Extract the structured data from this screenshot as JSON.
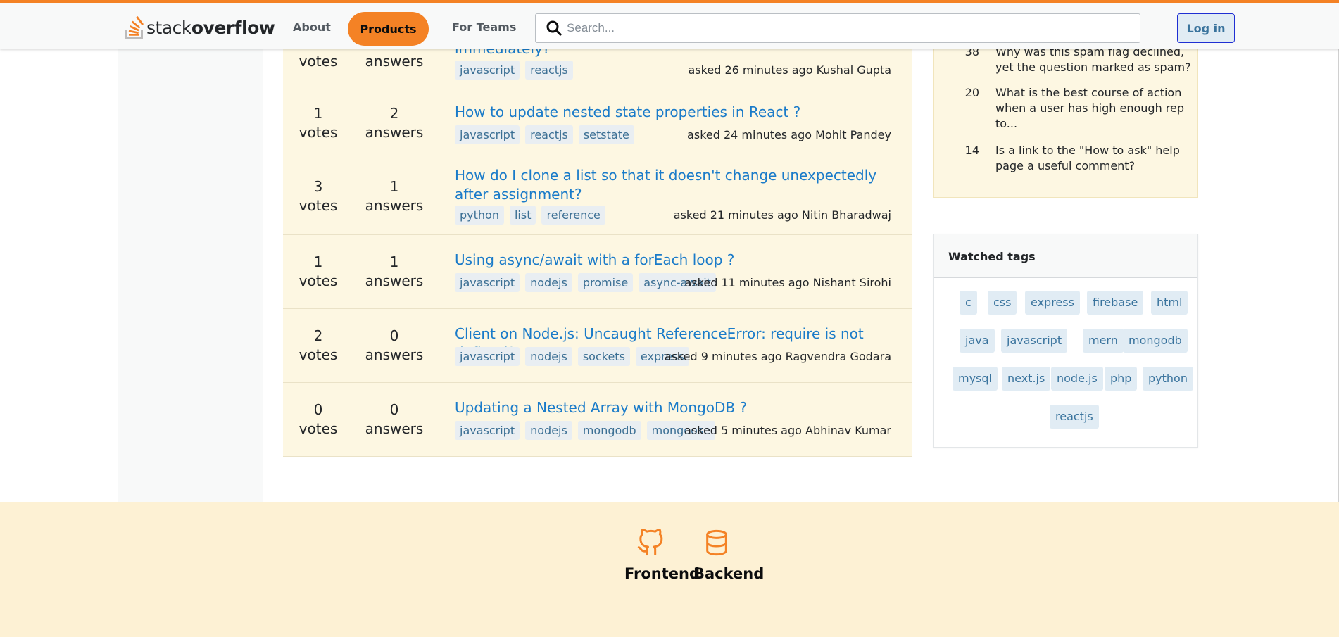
{
  "header": {
    "logo_stack": "stack",
    "logo_overflow": "overflow",
    "nav_about": "About",
    "nav_products": "Products",
    "nav_teams": "For Teams",
    "search_placeholder": "Search...",
    "login_label": "Log in",
    "accent_color": "#f48225"
  },
  "questions": [
    {
      "votes": "",
      "votes_label": "votes",
      "answers": "",
      "answers_label": "answers",
      "title": "immediately?",
      "tags": [
        "javascript",
        "reactjs"
      ],
      "asked": "asked 26 minutes ago",
      "author": "Kushal Gupta"
    },
    {
      "votes": "1",
      "votes_label": "votes",
      "answers": "2",
      "answers_label": "answers",
      "title": "How to update nested state properties in React ?",
      "tags": [
        "javascript",
        "reactjs",
        "setstate"
      ],
      "asked": "asked 24 minutes ago",
      "author": "Mohit Pandey"
    },
    {
      "votes": "3",
      "votes_label": "votes",
      "answers": "1",
      "answers_label": "answers",
      "title": "How do I clone a list so that it doesn't change unexpectedly after assignment?",
      "tags": [
        "python",
        "list",
        "reference"
      ],
      "asked": "asked 21 minutes ago",
      "author": "Nitin Bharadwaj"
    },
    {
      "votes": "1",
      "votes_label": "votes",
      "answers": "1",
      "answers_label": "answers",
      "title": "Using async/await with a forEach loop ?",
      "tags": [
        "javascript",
        "nodejs",
        "promise",
        "async-await"
      ],
      "asked": "asked 11 minutes ago",
      "author": "Nishant Sirohi"
    },
    {
      "votes": "2",
      "votes_label": "votes",
      "answers": "0",
      "answers_label": "answers",
      "title": "Client on Node.js: Uncaught ReferenceError: require is not defined?",
      "tags": [
        "javascript",
        "nodejs",
        "sockets",
        "express"
      ],
      "asked": "asked 9 minutes ago",
      "author": "Ragvendra Godara"
    },
    {
      "votes": "0",
      "votes_label": "votes",
      "answers": "0",
      "answers_label": "answers",
      "title": "Updating a Nested Array with MongoDB ?",
      "tags": [
        "javascript",
        "nodejs",
        "mongodb",
        "mongoose"
      ],
      "asked": "asked 5 minutes ago",
      "author": "Abhinav Kumar"
    }
  ],
  "featured": [
    {
      "count": "38",
      "text": "Why was this spam flag declined, yet the question marked as spam?"
    },
    {
      "count": "20",
      "text": "What is the best course of action when a user has high enough rep to..."
    },
    {
      "count": "14",
      "text": "Is a link to the \"How to ask\" help page a useful comment?"
    }
  ],
  "watched_tags": {
    "title": "Watched tags",
    "tags": [
      "c",
      "css",
      "express",
      "firebase",
      "html",
      "java",
      "javascript",
      "mern",
      "mongodb",
      "mysql",
      "next.js",
      "node.js",
      "php",
      "python",
      "reactjs"
    ]
  },
  "footer": {
    "frontend_label": "Frontend",
    "backend_label": "Backend",
    "icon_color": "#f48225"
  }
}
